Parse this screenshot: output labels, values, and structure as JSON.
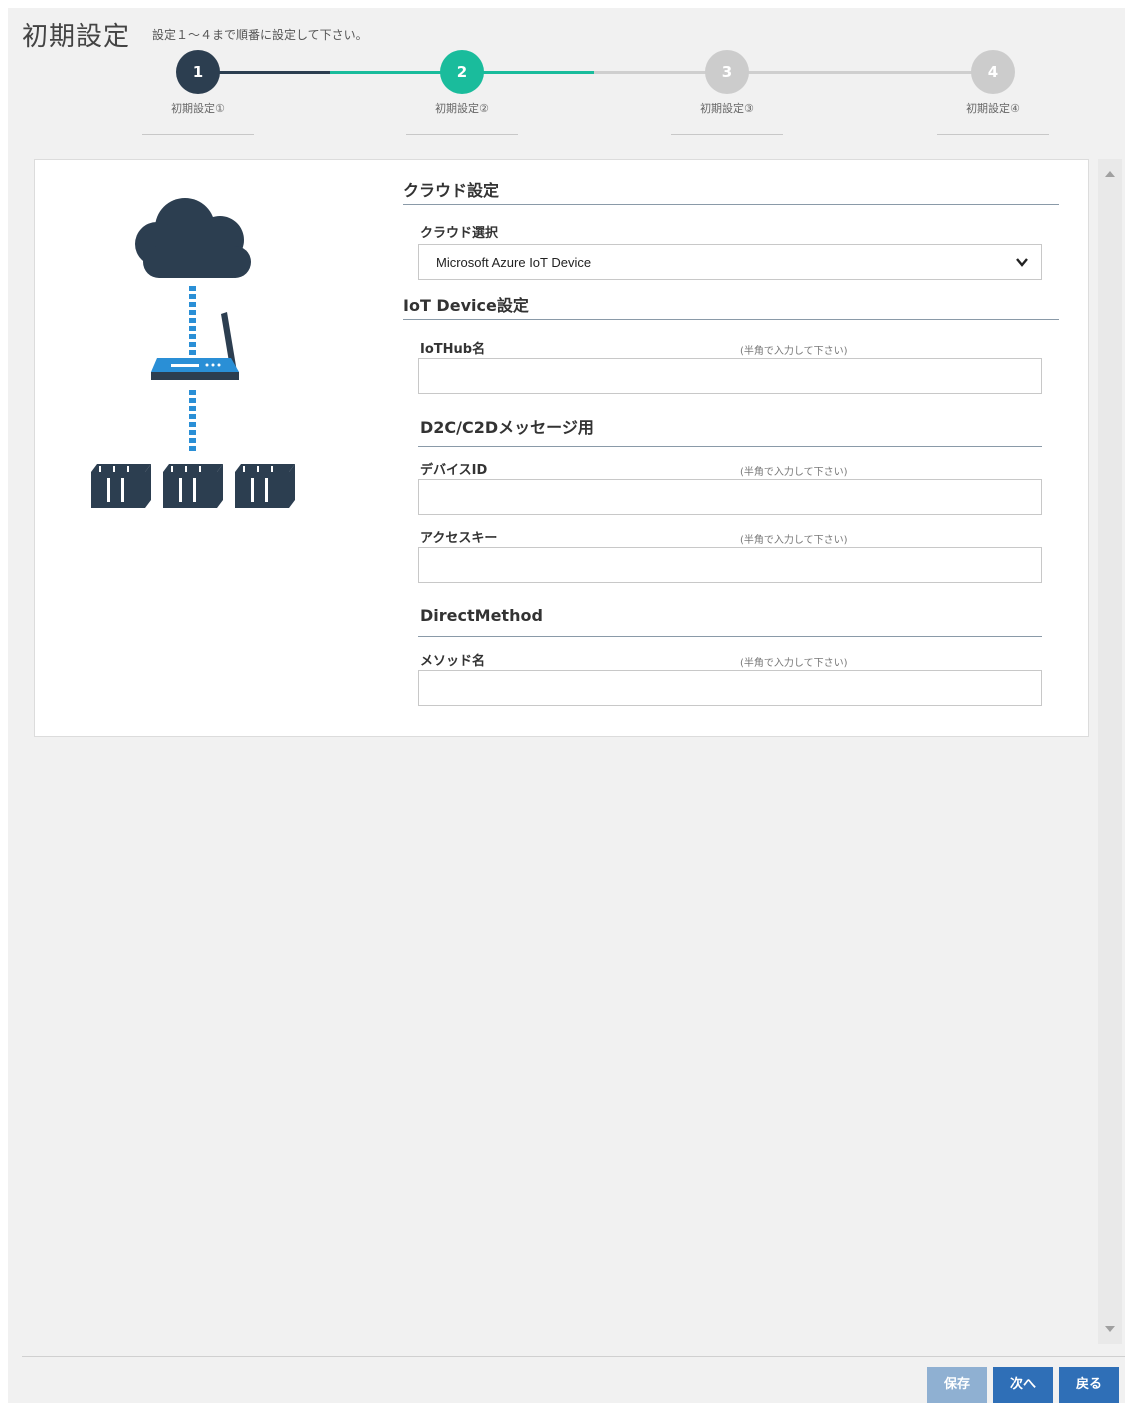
{
  "header": {
    "title": "初期設定",
    "subtitle": "設定１～４まで順番に設定して下さい。"
  },
  "steps": [
    {
      "number": "1",
      "label": "初期設定①",
      "state": "completed",
      "color": "#2c3e50"
    },
    {
      "number": "2",
      "label": "初期設定②",
      "state": "active",
      "color": "#1abc9c"
    },
    {
      "number": "3",
      "label": "初期設定③",
      "state": "pending",
      "color": "#cccccc"
    },
    {
      "number": "4",
      "label": "初期設定④",
      "state": "pending",
      "color": "#cccccc"
    }
  ],
  "cloud_section": {
    "title": "クラウド設定",
    "select_label": "クラウド選択",
    "select_value": "Microsoft Azure IoT Device"
  },
  "iot_section": {
    "title": "IoT Device設定",
    "hub_label": "IoTHub名",
    "hub_hint": "(半角で入力して下さい)",
    "hub_value": ""
  },
  "d2c_section": {
    "title": "D2C/C2Dメッセージ用",
    "device_id_label": "デバイスID",
    "device_id_hint": "(半角で入力して下さい)",
    "device_id_value": "",
    "access_key_label": "アクセスキー",
    "access_key_hint": "(半角で入力して下さい)",
    "access_key_value": ""
  },
  "direct_method_section": {
    "title": "DirectMethod",
    "method_label": "メソッド名",
    "method_hint": "(半角で入力して下さい)",
    "method_value": ""
  },
  "footer": {
    "save_label": "保存",
    "next_label": "次へ",
    "back_label": "戻る"
  },
  "colors": {
    "primary": "#2f6fb7",
    "disabled_button": "#8fb0d2",
    "accent_teal": "#1abc9c",
    "dark": "#2c3e50",
    "illustration_blue": "#2a8fd6"
  }
}
